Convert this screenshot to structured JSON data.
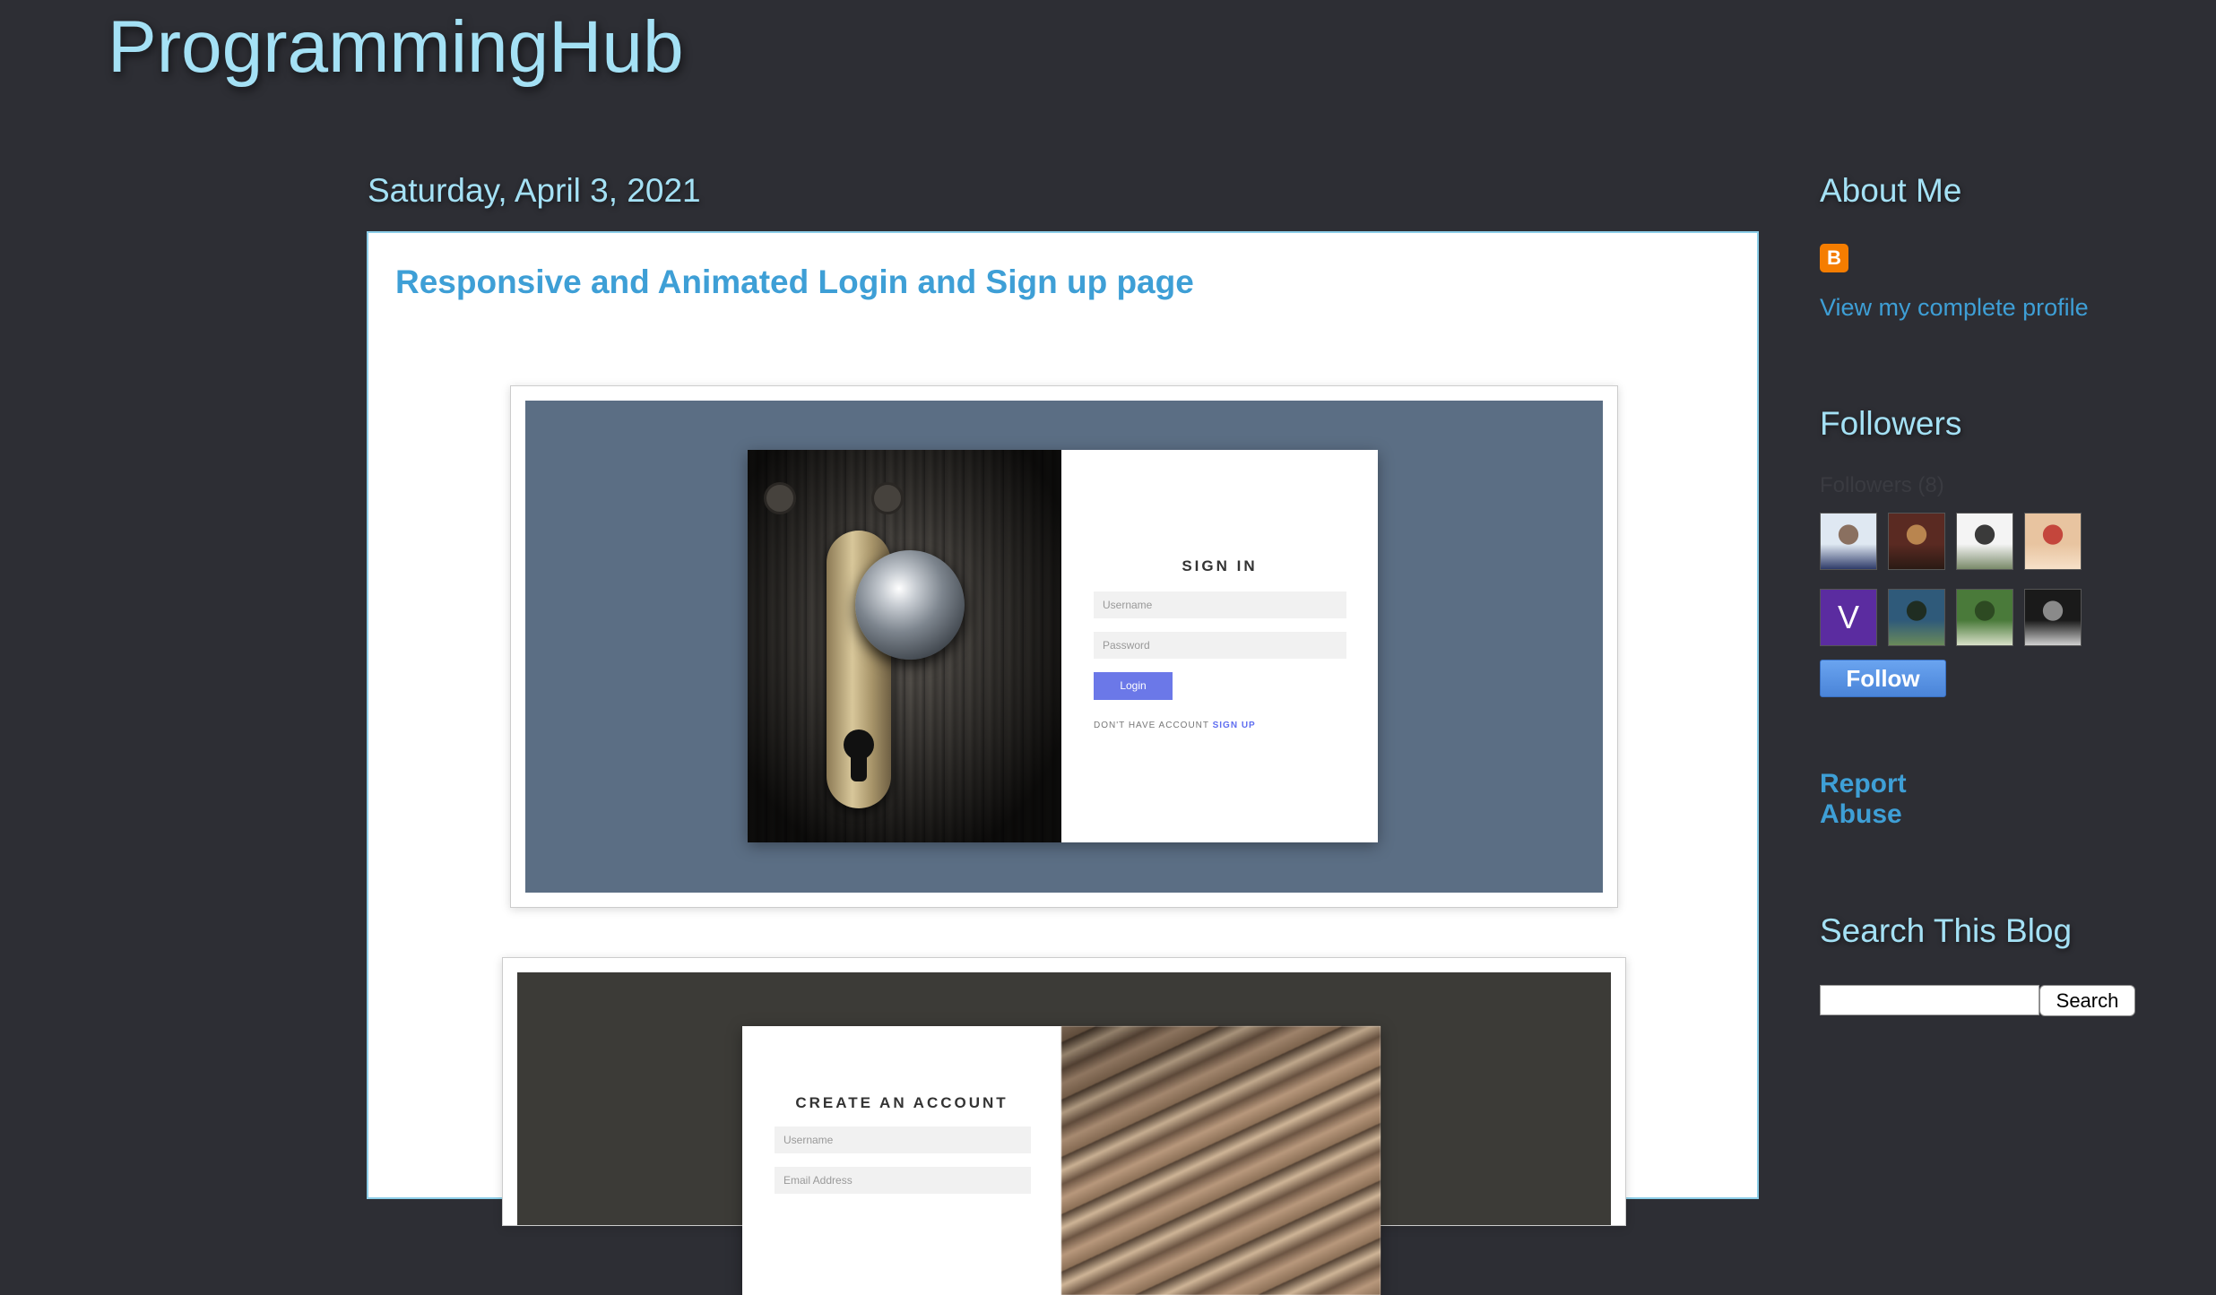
{
  "header": {
    "blog_title": "ProgrammingHub"
  },
  "post": {
    "date": "Saturday, April 3, 2021",
    "title": "Responsive and Animated Login and Sign up page",
    "image1": {
      "heading": "SIGN IN",
      "username_placeholder": "Username",
      "password_placeholder": "Password",
      "login_label": "Login",
      "account_prompt": "DON'T HAVE ACCOUNT",
      "signup_link": "SIGN UP"
    },
    "image2": {
      "heading": "CREATE AN ACCOUNT",
      "username_placeholder": "Username",
      "email_placeholder": "Email Address"
    }
  },
  "sidebar": {
    "about": {
      "heading": "About Me",
      "profile_link": "View my complete profile"
    },
    "followers": {
      "heading": "Followers",
      "subheading": "Followers (8)",
      "avatars": [
        {
          "name": "avatar-1",
          "colors": [
            "#dfe8f2",
            "#8a7060",
            "#2f3c6a"
          ]
        },
        {
          "name": "avatar-2",
          "colors": [
            "#5a2a22",
            "#b9854f",
            "#2a1a14"
          ]
        },
        {
          "name": "avatar-3",
          "colors": [
            "#f4f4f4",
            "#3a3a3a",
            "#7a8a6a"
          ]
        },
        {
          "name": "avatar-4",
          "colors": [
            "#e8c4a0",
            "#c4463c",
            "#f6e0c8"
          ]
        },
        {
          "name": "avatar-5",
          "letter": "V",
          "colors": [
            "#5b2ca0"
          ]
        },
        {
          "name": "avatar-6",
          "colors": [
            "#2f5a7a",
            "#1f2d22",
            "#6a8a5a"
          ]
        },
        {
          "name": "avatar-7",
          "colors": [
            "#4a7a3a",
            "#2d4a22",
            "#d8e0c8"
          ]
        },
        {
          "name": "avatar-8",
          "colors": [
            "#1a1a1a",
            "#8a8a8a",
            "#d0d0d0"
          ]
        }
      ],
      "follow_label": "Follow"
    },
    "report_abuse": "Report Abuse",
    "search": {
      "heading": "Search This Blog",
      "input_value": "",
      "button_label": "Search"
    }
  },
  "colors": {
    "background": "#2d2e34",
    "heading": "#a4e1f5",
    "link": "#3e9fd6",
    "post_bg": "#ffffff",
    "post_border": "#8ccee8",
    "blogger_orange": "#f57d00"
  },
  "icons": {
    "blogger": "blogger-icon"
  }
}
